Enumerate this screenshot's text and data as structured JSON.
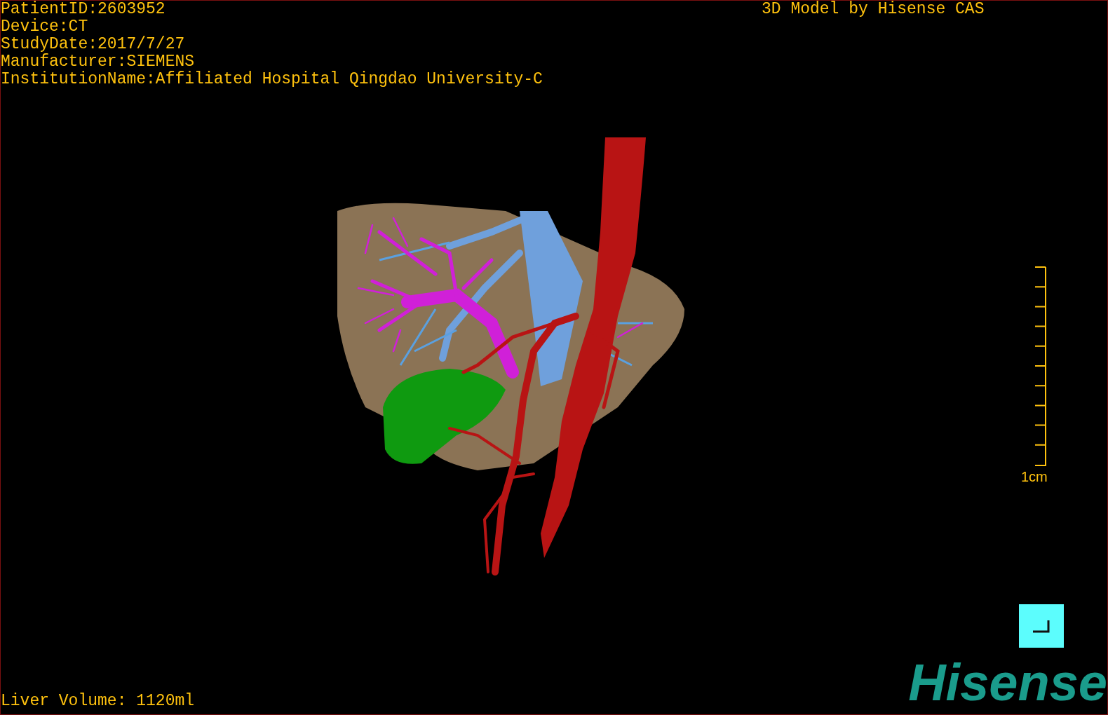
{
  "study_info": [
    "PatientID:2603952",
    "Device:CT",
    "StudyDate:2017/7/27",
    "Manufacturer:SIEMENS",
    "InstitutionName:Affiliated Hospital Qingdao University-C"
  ],
  "model_credit": "3D Model by Hisense CAS",
  "scale_bar": {
    "label": "1cm"
  },
  "liver_volume": "Liver Volume: 1120ml",
  "logo": "Hisense"
}
